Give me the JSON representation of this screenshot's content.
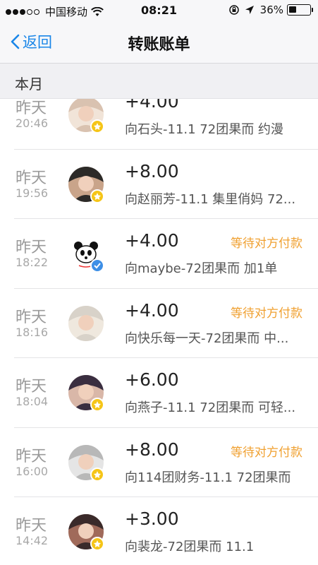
{
  "status_bar": {
    "carrier": "中国移动",
    "time": "08:21",
    "battery": "36%",
    "battery_level": 0.36
  },
  "nav": {
    "back_label": "返回",
    "title": "转账账单"
  },
  "section": {
    "title": "本月"
  },
  "colors": {
    "accent": "#1a86e8",
    "pending": "#f0a030",
    "badge_gold": "#f5c518",
    "badge_blue": "#3d8fe6"
  },
  "transactions": [
    {
      "date": "昨天",
      "time": "20:46",
      "amount": "+4.00",
      "status": "",
      "desc": "向石头-11.1 72团果而 约漫",
      "badge": "badge_gold",
      "avatar_icon": "user-avatar-icon"
    },
    {
      "date": "昨天",
      "time": "19:56",
      "amount": "+8.00",
      "status": "",
      "desc": "向赵丽芳-11.1 集里俏妈 72...",
      "badge": "badge_gold",
      "avatar_icon": "user-avatar-icon"
    },
    {
      "date": "昨天",
      "time": "18:22",
      "amount": "+4.00",
      "status": "等待对方付款",
      "desc": "向maybe-72团果而 加1单",
      "badge": "badge_blue",
      "avatar_icon": "panda-avatar-icon"
    },
    {
      "date": "昨天",
      "time": "18:16",
      "amount": "+4.00",
      "status": "等待对方付款",
      "desc": "向快乐每一天-72团果而 中...",
      "badge": "",
      "avatar_icon": "baby-avatar-icon"
    },
    {
      "date": "昨天",
      "time": "18:04",
      "amount": "+6.00",
      "status": "",
      "desc": "向燕子-11.1 72团果而 可轻...",
      "badge": "badge_gold",
      "avatar_icon": "user-avatar-icon"
    },
    {
      "date": "昨天",
      "time": "16:00",
      "amount": "+8.00",
      "status": "等待对方付款",
      "desc": "向114团财务-11.1 72团果而",
      "badge": "badge_gold",
      "avatar_icon": "user-avatar-icon"
    },
    {
      "date": "昨天",
      "time": "14:42",
      "amount": "+3.00",
      "status": "",
      "desc": "向裴龙-72团果而 11.1",
      "badge": "badge_gold",
      "avatar_icon": "user-avatar-icon"
    }
  ]
}
